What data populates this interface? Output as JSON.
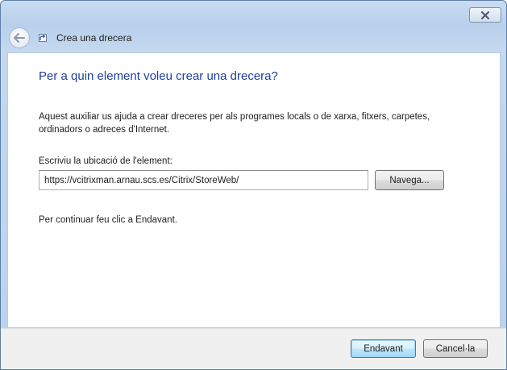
{
  "window": {
    "title": "Crea una drecera"
  },
  "wizard": {
    "heading": "Per a quin element voleu crear una drecera?",
    "description": "Aquest auxiliar us ajuda a crear dreceres per als programes locals o de xarxa, fitxers, carpetes, ordinadors o adreces d'Internet.",
    "location_label": "Escriviu la ubicació de l'element:",
    "location_value": "https://vcitrixman.arnau.scs.es/Citrix/StoreWeb/",
    "browse_label": "Navega...",
    "continue_text": "Per continuar feu clic a Endavant."
  },
  "footer": {
    "next_label": "Endavant",
    "cancel_label": "Cancel·la"
  },
  "icons": {
    "close": "close-icon",
    "back": "back-arrow-icon",
    "shortcut": "shortcut-icon"
  },
  "colors": {
    "heading": "#1e3fa0",
    "frame": "#b8d0ec",
    "footer": "#f0f0f0"
  }
}
